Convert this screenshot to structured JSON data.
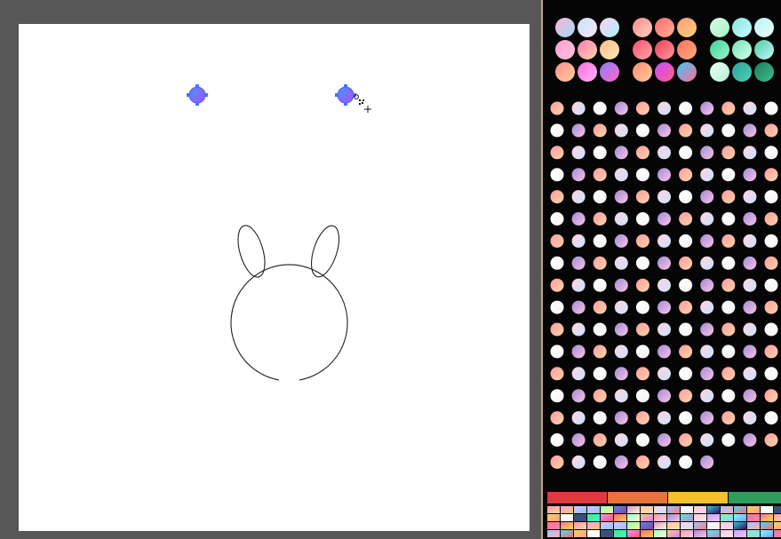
{
  "app": {
    "accent": "#7b5cff",
    "workspace_bg": "#575757",
    "artboard_bg": "#ffffff",
    "panel_bg": "#050505"
  },
  "canvas": {
    "drawing": "bunny-outline",
    "handles": [
      {
        "name": "gradient-handle-left",
        "colors": [
          "#4f8dff",
          "#b14dff"
        ]
      },
      {
        "name": "gradient-handle-right",
        "colors": [
          "#4f8dff",
          "#b14dff"
        ]
      }
    ],
    "cursor": "gradient-pen-cursor"
  },
  "swatches": {
    "large_groups": [
      [
        [
          "#f8b6d7",
          "#a4d8f5"
        ],
        [
          "#c3e6ff",
          "#fbe3f3"
        ],
        [
          "#ffd1ec",
          "#a7f2ff"
        ],
        [
          "#ff9ed1",
          "#ffc3e0"
        ],
        [
          "#ff7ab4",
          "#ffd7a8"
        ],
        [
          "#ffbe8a",
          "#ffe8b6"
        ],
        [
          "#ff8f8f",
          "#ffcf9e"
        ],
        [
          "#ff6ee2",
          "#ffb4f5"
        ],
        [
          "#8e7bff",
          "#ff6ac1"
        ]
      ],
      [
        [
          "#ff8a8a",
          "#ffd2c0"
        ],
        [
          "#ff6b6b",
          "#ffb199"
        ],
        [
          "#ff9a7a",
          "#ffd27a"
        ],
        [
          "#ff4d6d",
          "#ffa8a8"
        ],
        [
          "#e83e54",
          "#ff9aa2"
        ],
        [
          "#ff6f61",
          "#ffb07c"
        ],
        [
          "#ff8c6b",
          "#ffcaa0"
        ],
        [
          "#c94dff",
          "#ff5e8a"
        ],
        [
          "#3ec6ff",
          "#ff6f91"
        ]
      ],
      [
        [
          "#d7ffe7",
          "#a8f0c6"
        ],
        [
          "#8ae3e0",
          "#c6fbff"
        ],
        [
          "#b5f5ff",
          "#eafff2"
        ],
        [
          "#3fd39b",
          "#9cf3c9"
        ],
        [
          "#6fe3b3",
          "#d8ffef"
        ],
        [
          "#4bcfa0",
          "#c4f5ff"
        ],
        [
          "#e8fff3",
          "#b9f0da"
        ],
        [
          "#2a9fa0",
          "#4ed3b4"
        ],
        [
          "#1e7a5a",
          "#3dbf8e"
        ]
      ]
    ],
    "grid_colors": [
      [
        "#ff9aa2",
        "#ffd6a5"
      ],
      [
        "#a0c4ff",
        "#ffadad"
      ],
      [
        "#f8c8dc",
        "#ffe5ec"
      ],
      [
        "#ffc6a0",
        "#ffe0b5"
      ],
      [
        "#ff6b6b",
        "#feca57"
      ],
      [
        "#ff9ff3",
        "#feca57"
      ],
      [
        "#48dbfb",
        "#ff6b6b"
      ],
      [
        "#c8a2ff",
        "#f0c3ff"
      ],
      [
        "#ffd3e0",
        "#c9e4ff"
      ],
      [
        "#a1ffce",
        "#faffd1"
      ],
      [
        "#e0c3fc",
        "#8ec5fc"
      ],
      [
        "#f6d365",
        "#fda085"
      ],
      [
        "#84fab0",
        "#8fd3f4"
      ],
      [
        "#a6c0fe",
        "#f68084"
      ],
      [
        "#fccb90",
        "#d57eeb"
      ],
      [
        "#e0c3fc",
        "#8ec5fc"
      ],
      [
        "#ffffff",
        "#f5f5f5"
      ],
      [
        "#89f7fe",
        "#66a6ff"
      ],
      [
        "#fdfbfb",
        "#ebedee"
      ],
      [
        "#ff9a9e",
        "#fecfef"
      ],
      [
        "#96fbc4",
        "#f9f586"
      ],
      [
        "#2b5876",
        "#4e4376"
      ],
      [
        "#ff758c",
        "#ff7eb3"
      ],
      [
        "#fad0c4",
        "#ffd1ff"
      ],
      [
        "#a18cd1",
        "#fbc2eb"
      ],
      [
        "#667eea",
        "#764ba2"
      ],
      [
        "#43e97b",
        "#38f9d7"
      ],
      [
        "#fa709a",
        "#fee140"
      ],
      [
        "#30cfd0",
        "#330867"
      ],
      [
        "#5ee7df",
        "#b490ca"
      ],
      [
        "#d299c2",
        "#fef9d7"
      ],
      [
        "#f093fb",
        "#f5576c"
      ]
    ],
    "strip_colors": [
      "#e03a3e",
      "#e8743b",
      "#f7c02f",
      "#2e9d5b",
      "#2f7fd6",
      "#8b4fd8"
    ]
  }
}
